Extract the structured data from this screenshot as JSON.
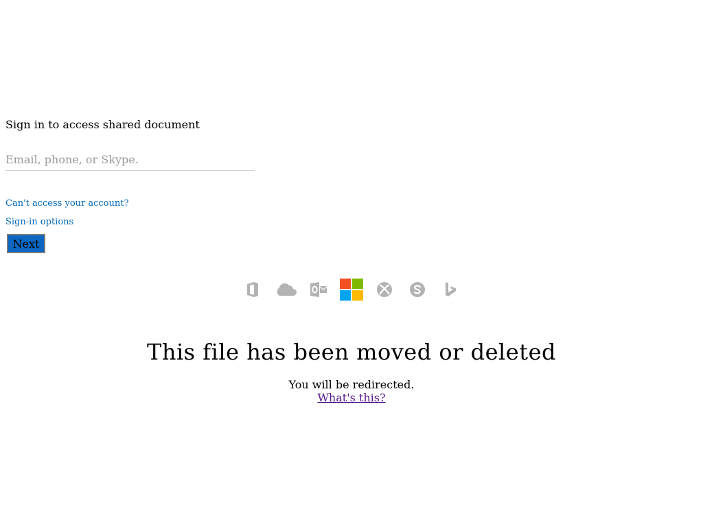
{
  "signin": {
    "title": "Sign in to access shared document",
    "email_placeholder": "Email, phone, or Skype.",
    "email_value": "",
    "cant_access_label": "Can't access your account?",
    "signin_options_label": "Sign-in options",
    "next_label": "Next"
  },
  "brand_icons": [
    "office-icon",
    "onedrive-icon",
    "outlook-icon",
    "microsoft-logo",
    "xbox-icon",
    "skype-icon",
    "bing-icon"
  ],
  "colors": {
    "link": "#0067b8",
    "button_bg": "#0c67c3",
    "icon_gray": "#b3b3b3",
    "visited_link": "#551a8b",
    "ms_red": "#f25022",
    "ms_green": "#7fba00",
    "ms_blue": "#00a4ef",
    "ms_yellow": "#ffb900"
  },
  "status": {
    "heading": "This file has been moved or deleted",
    "message": "You will be redirected.",
    "whats_this_label": "What's this?"
  }
}
